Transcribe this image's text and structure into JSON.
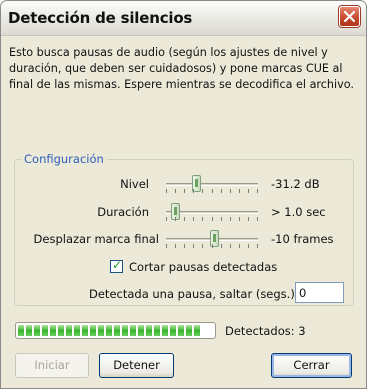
{
  "window": {
    "title": "Detección de silencios"
  },
  "description": "Esto busca pausas de audio (según los ajustes de nivel y duración, que deben ser cuidadosos) y pone marcas CUE al final de las mismas. Espere mientras se decodifica el archivo.",
  "config": {
    "legend": "Configuración",
    "sliders": [
      {
        "label": "Nivel",
        "value_text": "-31.2 dB",
        "position": 0.33
      },
      {
        "label": "Duración",
        "value_text": "> 1.0 sec",
        "position": 0.1
      },
      {
        "label": "Desplazar marca final",
        "value_text": "-10 frames",
        "position": 0.52
      }
    ],
    "checkbox": {
      "label": "Cortar pausas detectadas",
      "checked": true
    },
    "skip": {
      "label": "Detectada una pausa, saltar (segs.)",
      "value": "0"
    }
  },
  "progress": {
    "segments_filled": 23,
    "fraction": 1.0,
    "status": "Detectados: 3"
  },
  "buttons": {
    "start": "Iniciar",
    "stop": "Detener",
    "close": "Cerrar"
  },
  "colors": {
    "legend": "#2c5fb9",
    "progress": "#39b32c",
    "close_button": "#c4462a"
  }
}
